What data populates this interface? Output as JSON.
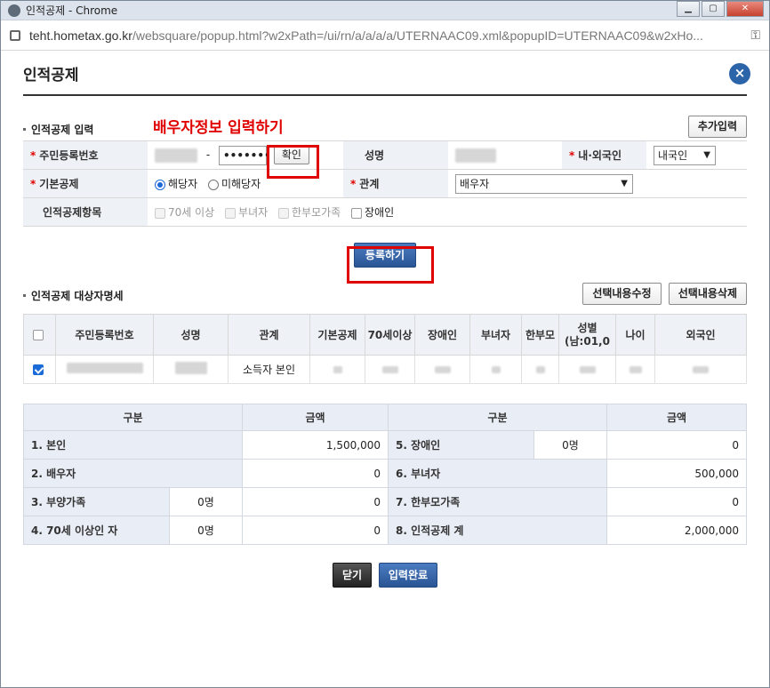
{
  "window": {
    "title": "인적공제 - Chrome",
    "url_host": "teht.hometax.go.kr",
    "url_rest": "/websquare/popup.html?w2xPath=/ui/rn/a/a/a/a/UTERNAAC09.xml&popupID=UTERNAAC09&w2xHo..."
  },
  "popup": {
    "title": "인적공제"
  },
  "input_section": {
    "header": "인적공제 입력",
    "add_button": "추가입력",
    "annotation": "배우자정보 입력하기",
    "rrn_label": "주민등록번호",
    "rrn_back": "•••••••",
    "confirm_button": "확인",
    "name_label": "성명",
    "nationality_label": "내·외국인",
    "nationality_value": "내국인",
    "basic_deduction_label": "기본공제",
    "radio_yes": "해당자",
    "radio_no": "미해당자",
    "relation_label": "관계",
    "relation_value": "배우자",
    "items_label": "인적공제항목",
    "item_age70": "70세 이상",
    "item_woman": "부녀자",
    "item_single_parent": "한부모가족",
    "item_disabled": "장애인",
    "register_button": "등록하기"
  },
  "list_section": {
    "header": "인적공제 대상자명세",
    "edit_button": "선택내용수정",
    "delete_button": "선택내용삭제",
    "columns": [
      "주민등록번호",
      "성명",
      "관계",
      "기본공제",
      "70세이상",
      "장애인",
      "부녀자",
      "한부모",
      "성별\n(남:01,0",
      "나이",
      "외국인"
    ],
    "rows": [
      {
        "relation": "소득자 본인"
      }
    ]
  },
  "summary": {
    "col_category": "구분",
    "col_amount": "금액",
    "left": [
      {
        "label": "1. 본인",
        "count": "",
        "amount": "1,500,000"
      },
      {
        "label": "2. 배우자",
        "count": "",
        "amount": "0"
      },
      {
        "label": "3. 부양가족",
        "count": "0명",
        "amount": "0"
      },
      {
        "label": "4. 70세 이상인 자",
        "count": "0명",
        "amount": "0"
      }
    ],
    "right": [
      {
        "label": "5. 장애인",
        "count": "0명",
        "amount": "0"
      },
      {
        "label": "6. 부녀자",
        "count": "",
        "amount": "500,000"
      },
      {
        "label": "7. 한부모가족",
        "count": "",
        "amount": "0"
      },
      {
        "label": "8. 인적공제 계",
        "count": "",
        "amount": "2,000,000"
      }
    ]
  },
  "footer": {
    "close_button": "닫기",
    "complete_button": "입력완료"
  }
}
